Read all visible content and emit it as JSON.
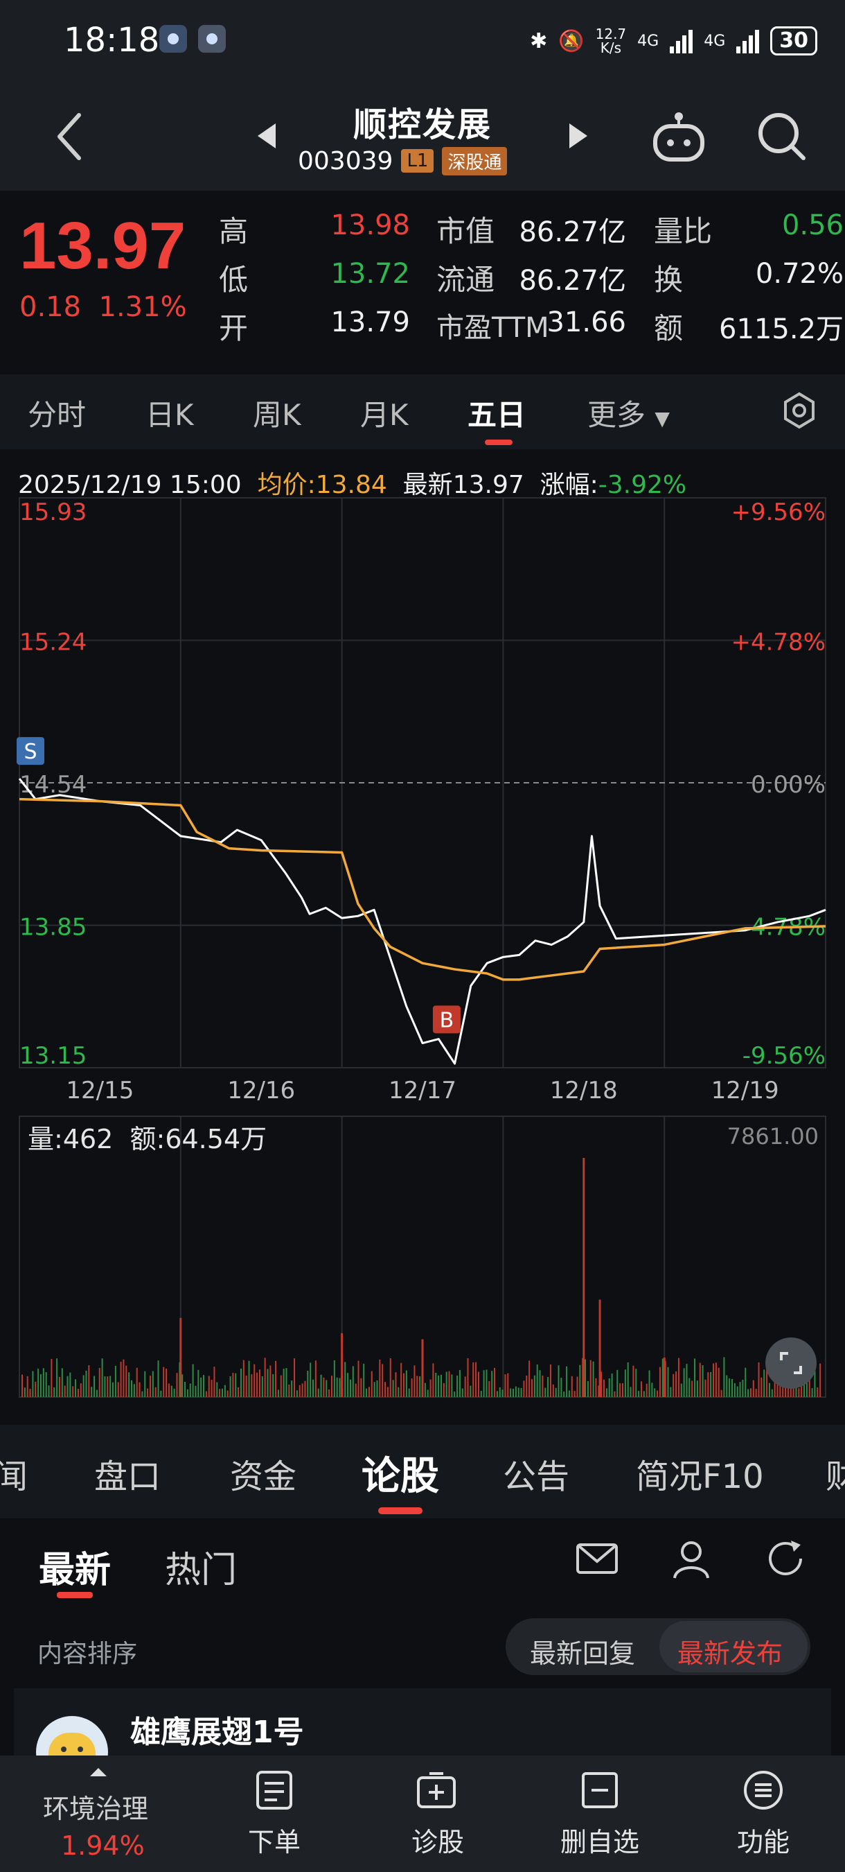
{
  "status_bar": {
    "time": "18:18",
    "net_speed_top": "12.7",
    "net_speed_bottom": "K/s",
    "net1": "4G",
    "net2": "4G",
    "battery": "30"
  },
  "header": {
    "title": "顺控发展",
    "code": "003039",
    "level_tag": "L1",
    "connect_tag": "深股通"
  },
  "quote": {
    "price": "13.97",
    "change": "0.18",
    "change_pct": "1.31%",
    "high_label": "高",
    "high": "13.98",
    "low_label": "低",
    "low": "13.72",
    "open_label": "开",
    "open": "13.79",
    "mcap_label": "市值",
    "mcap": "86.27亿",
    "float_label": "流通",
    "float": "86.27亿",
    "pe_label": "市盈TTM",
    "pe": "31.66",
    "vr_label": "量比",
    "vr": "0.56",
    "turnover_label": "换",
    "turnover": "0.72%",
    "amount_label": "额",
    "amount": "6115.2万"
  },
  "period_tabs": [
    "分时",
    "日K",
    "周K",
    "月K",
    "五日",
    "更多"
  ],
  "active_period": "五日",
  "chart_info": {
    "datetime": "2025/12/19 15:00",
    "avg_label": "均价:",
    "avg": "13.84",
    "latest_label": "最新",
    "latest": "13.97",
    "chg_label": "涨幅:",
    "chg": "-3.92%"
  },
  "chart_data": {
    "type": "line",
    "y_left_ticks": [
      "15.93",
      "15.24",
      "14.54",
      "13.85",
      "13.15"
    ],
    "y_right_ticks": [
      "+9.56%",
      "+4.78%",
      "0.00%",
      "-4.78%",
      "-9.56%"
    ],
    "ylim": [
      13.15,
      15.93
    ],
    "x_ticks": [
      "12/15",
      "12/16",
      "12/17",
      "12/18",
      "12/19"
    ],
    "series": [
      {
        "color": "#ffffff",
        "x": [
          0,
          0.02,
          0.05,
          0.1,
          0.15,
          0.2,
          0.25,
          0.27,
          0.3,
          0.33,
          0.35,
          0.36,
          0.38,
          0.4,
          0.42,
          0.44,
          0.48,
          0.5,
          0.52,
          0.54,
          0.56,
          0.58,
          0.6,
          0.62,
          0.64,
          0.66,
          0.68,
          0.7,
          0.71,
          0.72,
          0.74,
          0.78,
          0.82,
          0.86,
          0.9,
          0.94,
          0.98,
          1.0
        ],
        "y": [
          14.56,
          14.46,
          14.48,
          14.45,
          14.43,
          14.28,
          14.25,
          14.31,
          14.26,
          14.1,
          13.98,
          13.9,
          13.93,
          13.88,
          13.89,
          13.92,
          13.45,
          13.27,
          13.29,
          13.17,
          13.55,
          13.66,
          13.69,
          13.7,
          13.77,
          13.75,
          13.79,
          13.86,
          14.28,
          13.94,
          13.78,
          13.79,
          13.8,
          13.81,
          13.82,
          13.86,
          13.89,
          13.92
        ]
      },
      {
        "color": "#f2a93b",
        "x": [
          0,
          0.1,
          0.2,
          0.22,
          0.26,
          0.3,
          0.4,
          0.42,
          0.44,
          0.46,
          0.5,
          0.54,
          0.58,
          0.6,
          0.62,
          0.66,
          0.7,
          0.72,
          0.8,
          0.9,
          1.0
        ],
        "y": [
          14.46,
          14.45,
          14.43,
          14.3,
          14.22,
          14.21,
          14.2,
          13.95,
          13.83,
          13.74,
          13.66,
          13.63,
          13.61,
          13.58,
          13.58,
          13.6,
          13.62,
          13.73,
          13.75,
          13.83,
          13.84
        ]
      }
    ],
    "markers": [
      {
        "label": "S",
        "series": 0,
        "x": 0.0
      },
      {
        "label": "B",
        "series": 0,
        "x": 0.53
      }
    ],
    "volume": {
      "label": "量:",
      "value": "462",
      "amount_label": "额:",
      "amount": "64.54万",
      "max_label": "7861.00",
      "spikes": [
        {
          "x": 0.2,
          "v": 2600
        },
        {
          "x": 0.4,
          "v": 2100
        },
        {
          "x": 0.5,
          "v": 1900
        },
        {
          "x": 0.7,
          "v": 7861
        },
        {
          "x": 0.72,
          "v": 3200
        },
        {
          "x": 0.8,
          "v": 1300
        }
      ]
    }
  },
  "section_tabs": [
    "闻",
    "盘口",
    "资金",
    "论股",
    "公告",
    "简况F10",
    "财"
  ],
  "active_section": "论股",
  "forum": {
    "tabs": [
      "最新",
      "热门"
    ],
    "sort_label": "内容排序",
    "sort_reply": "最新回复",
    "sort_publish": "最新发布",
    "post_user": "雄鹰展翅1号"
  },
  "bottom_bar": {
    "index_name": "环境治理",
    "index_change": "1.94%",
    "order": "下单",
    "diagnose": "诊股",
    "remove_watch": "删自选",
    "functions": "功能"
  }
}
